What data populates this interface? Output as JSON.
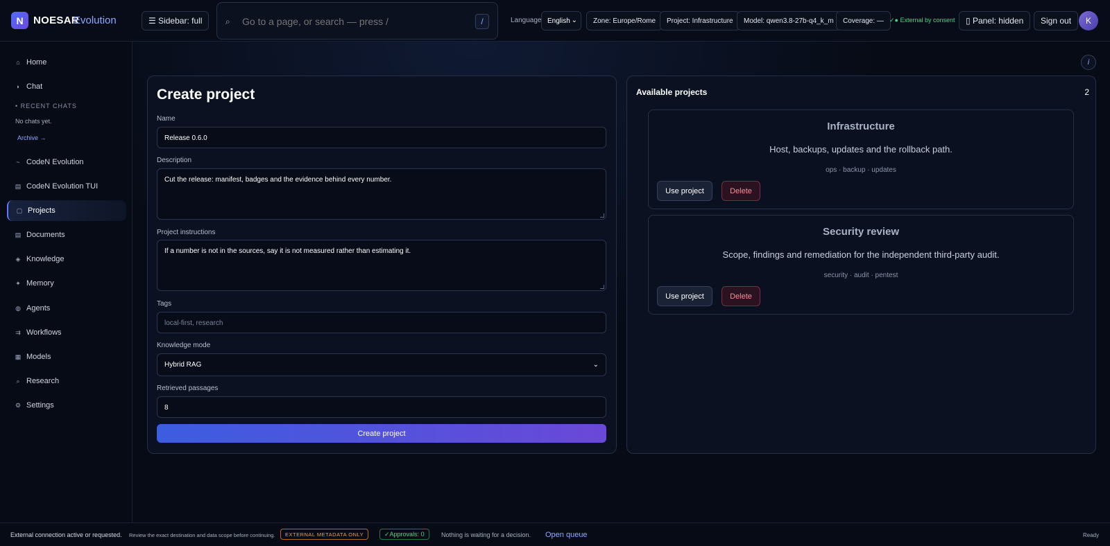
{
  "brand": {
    "logo_letter": "N",
    "name": "NOESAR",
    "sub": "Evolution"
  },
  "topbar": {
    "sidebar_toggle": "☰ Sidebar: full",
    "search_placeholder": "Go to a page, or search — press /",
    "search_key": "/",
    "language_label": "Language",
    "language_value": "English",
    "zone": "Zone: Europe/Rome",
    "project": "Project: Infrastructure",
    "model": "Model: qwen3.8-27b-q4_k_m",
    "coverage": "Coverage: —",
    "consent": "✓● External by consent",
    "panel_toggle": "▯ Panel: hidden",
    "sign_out": "Sign out",
    "avatar": "K",
    "info": "i"
  },
  "sidebar": {
    "items": [
      {
        "icon": "⌂",
        "label": "Home"
      },
      {
        "icon": "◗",
        "label": "Chat"
      },
      {
        "icon": "~",
        "label": "CodeN Evolution"
      },
      {
        "icon": "▤",
        "label": "CodeN Evolution TUI"
      },
      {
        "icon": "▢",
        "label": "Projects"
      },
      {
        "icon": "▤",
        "label": "Documents"
      },
      {
        "icon": "◈",
        "label": "Knowledge"
      },
      {
        "icon": "✦",
        "label": "Memory"
      },
      {
        "icon": "◍",
        "label": "Agents"
      },
      {
        "icon": "⇉",
        "label": "Workflows"
      },
      {
        "icon": "▦",
        "label": "Models"
      },
      {
        "icon": "⌕",
        "label": "Research"
      },
      {
        "icon": "⚙",
        "label": "Settings"
      }
    ],
    "recent_heading": "• RECENT CHATS",
    "no_chats": "No chats yet.",
    "archive": "Archive →"
  },
  "form": {
    "title": "Create project",
    "name_label": "Name",
    "name_value": "Release 0.6.0",
    "description_label": "Description",
    "description_value": "Cut the release: manifest, badges and the evidence behind every number.",
    "instructions_label": "Project instructions",
    "instructions_value": "If a number is not in the sources, say it is not measured rather than estimating it.",
    "tags_label": "Tags",
    "tags_placeholder": "local-first, research",
    "mode_label": "Knowledge mode",
    "mode_value": "Hybrid RAG",
    "passages_label": "Retrieved passages",
    "passages_value": "8",
    "submit": "Create project"
  },
  "projects": {
    "title": "Available projects",
    "count": "2",
    "items": [
      {
        "name": "Infrastructure",
        "description": "Host, backups, updates and the rollback path.",
        "tags": "ops · backup · updates",
        "use": "Use project",
        "delete": "Delete"
      },
      {
        "name": "Security review",
        "description": "Scope, findings and remediation for the independent third-party audit.",
        "tags": "security · audit · pentest",
        "use": "Use project",
        "delete": "Delete"
      }
    ]
  },
  "footer": {
    "status": "External connection active or requested.",
    "note": "Review the exact destination and data scope before continuing.",
    "ext_badge": "EXTERNAL METADATA ONLY",
    "approvals": "✓Approvals: 0",
    "waiting": "Nothing is waiting for a decision.",
    "queue": "Open queue",
    "ready": "Ready"
  }
}
